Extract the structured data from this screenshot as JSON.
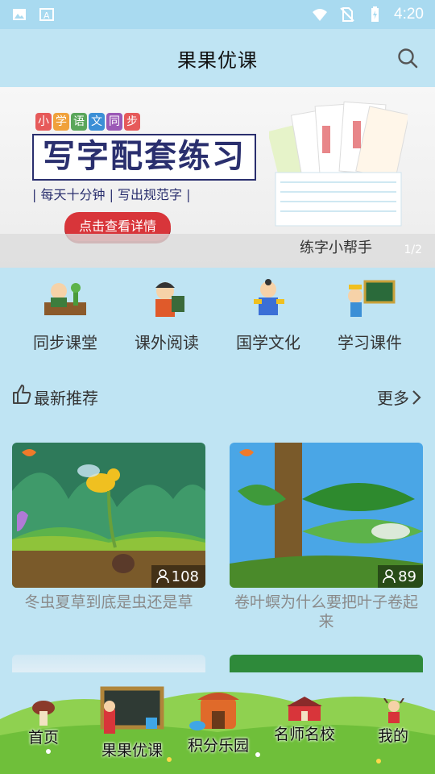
{
  "status_bar": {
    "time": "4:20"
  },
  "header": {
    "title": "果果优课",
    "search_icon": "search-icon"
  },
  "banner": {
    "tag_chars": [
      "小",
      "学",
      "语",
      "文",
      "同",
      "步"
    ],
    "tag_colors": [
      "#e65a5a",
      "#f0a13b",
      "#5aa65a",
      "#3b8fd6",
      "#9b59b6",
      "#e65a5a"
    ],
    "title": "写字配套练习",
    "subtitle": "| 每天十分钟 | 写出规范字 |",
    "button_label": "点击查看详情",
    "caption": "练字小帮手",
    "page_indicator": "1/2"
  },
  "categories": [
    {
      "label": "同步课堂",
      "icon": "classroom-icon"
    },
    {
      "label": "课外阅读",
      "icon": "reading-icon"
    },
    {
      "label": "国学文化",
      "icon": "guoxue-icon"
    },
    {
      "label": "学习课件",
      "icon": "courseware-icon"
    }
  ],
  "section": {
    "title": "最新推荐",
    "more_label": "更多"
  },
  "cards": [
    {
      "title": "冬虫夏草到底是虫还是草",
      "views": "108"
    },
    {
      "title": "卷叶螟为什么要把叶子卷起来",
      "views": "89"
    }
  ],
  "bottom_nav": [
    {
      "label": "首页",
      "icon": "home-icon",
      "active": false
    },
    {
      "label": "果果优课",
      "icon": "blackboard-icon",
      "active": true
    },
    {
      "label": "积分乐园",
      "icon": "points-park-icon",
      "active": false
    },
    {
      "label": "名师名校",
      "icon": "school-icon",
      "active": false
    },
    {
      "label": "我的",
      "icon": "profile-icon",
      "active": false
    }
  ],
  "colors": {
    "background": "#bfe4f3",
    "accent_red": "#d8353a",
    "nav_grass": "#7cc243"
  }
}
